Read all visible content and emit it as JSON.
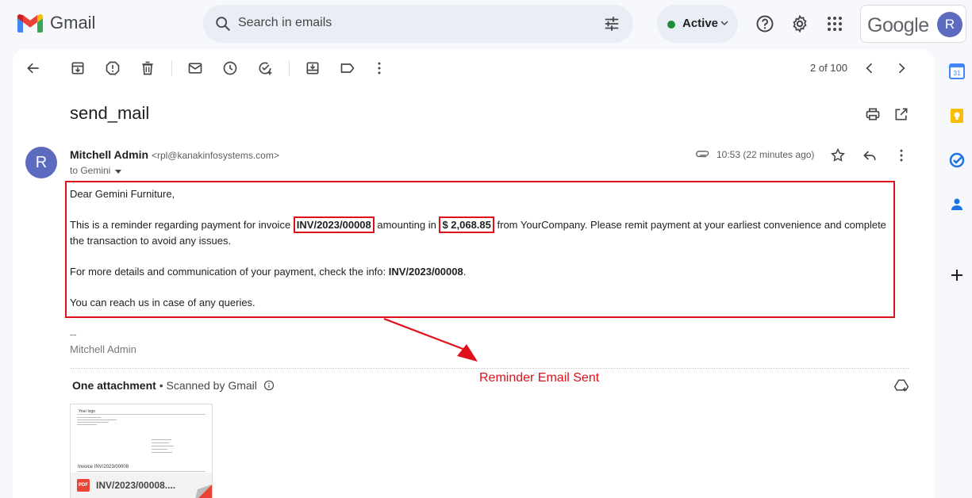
{
  "app": {
    "name": "Gmail"
  },
  "search": {
    "placeholder": "Search in emails"
  },
  "status": {
    "label": "Active",
    "color": "#1e8e3e"
  },
  "account": {
    "brand": "Google",
    "initial": "R"
  },
  "toolbar": {
    "icons": [
      "back-arrow-icon",
      "archive-icon",
      "report-spam-icon",
      "delete-icon",
      "mark-unread-icon",
      "snooze-icon",
      "add-task-icon",
      "move-to-icon",
      "label-icon",
      "more-vert-icon"
    ],
    "pager": "2 of 100"
  },
  "email": {
    "subject": "send_mail",
    "sender_name": "Mitchell Admin",
    "sender_email": "<rpl@kanakinfosystems.com>",
    "to": "to Gemini",
    "time": "10:53 (22 minutes ago)",
    "avatar_initial": "R",
    "greeting": "Dear Gemini Furniture,",
    "para1_a": "This is a reminder regarding payment for invoice ",
    "invoice": "INV/2023/00008",
    "para1_b": " amounting in ",
    "amount": "$ 2,068.85",
    "para1_c": " from YourCompany. Please remit payment at your earliest convenience and complete the transaction to avoid any issues.",
    "para2_a": "For more details and communication of your payment, check the info: ",
    "para2_ref": "INV/2023/00008",
    "para2_b": ".",
    "para3": "You can reach us in case of any queries.",
    "sig_dash": "--",
    "sig_name": "Mitchell Admin"
  },
  "annotation": {
    "text": "Reminder Email Sent",
    "color": "#e0101a"
  },
  "attachments": {
    "title": "One attachment",
    "scanned": " • Scanned by Gmail",
    "file": {
      "name": "INV/2023/00008....",
      "type": "PDF",
      "preview_logo": "Your logo",
      "preview_title": "Invoice INV/2023/00008"
    }
  },
  "side_panel": {
    "icons": [
      "calendar-icon",
      "keep-icon",
      "tasks-icon",
      "contacts-icon",
      "add-icon"
    ],
    "calendar_day": "31"
  }
}
